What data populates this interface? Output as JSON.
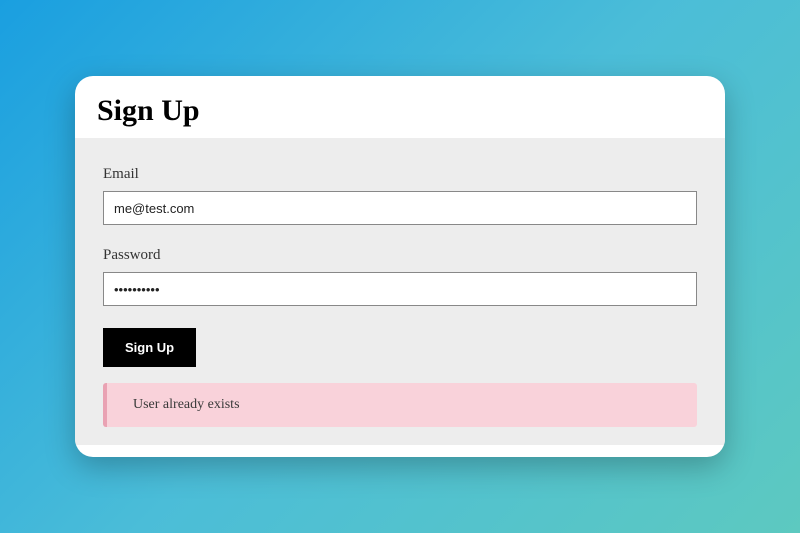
{
  "header": {
    "title": "Sign Up"
  },
  "form": {
    "email": {
      "label": "Email",
      "value": "me@test.com",
      "placeholder": ""
    },
    "password": {
      "label": "Password",
      "value": "••••••••••",
      "placeholder": ""
    },
    "submit_label": "Sign Up"
  },
  "alert": {
    "message": "User already exists"
  }
}
